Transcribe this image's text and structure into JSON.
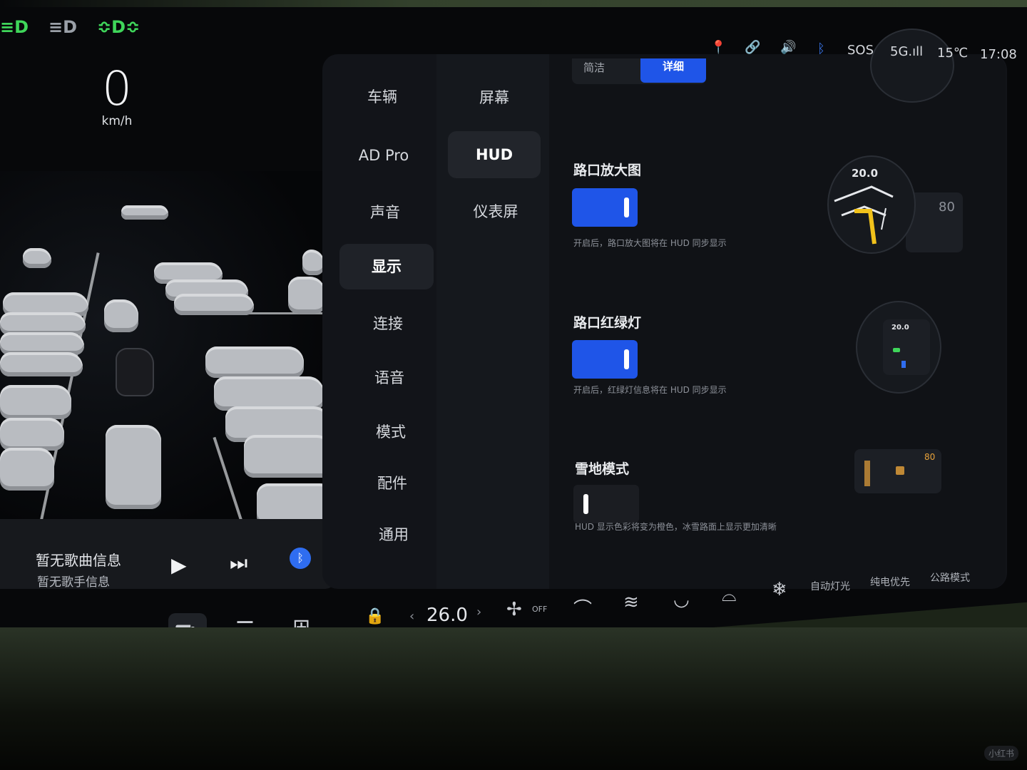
{
  "telltales": [
    {
      "icon": "headlight-icon",
      "glyph": "≡D",
      "color": "#3fd65a"
    },
    {
      "icon": "auto-headlight-icon",
      "glyph": "≡D",
      "color": "#9aa0a8"
    },
    {
      "icon": "parking-light-icon",
      "glyph": "≎D≎",
      "color": "#3fd65a"
    }
  ],
  "speed": {
    "value": "0",
    "unit": "km/h"
  },
  "media": {
    "song": "暂无歌曲信息",
    "artist": "暂无歌手信息",
    "play_icon": "▶",
    "next_icon": "⏭",
    "bt_icon": "ᛒ"
  },
  "status_bar": {
    "location_icon": "📍",
    "link_icon": "🔗",
    "volume_icon": "🔊",
    "bluetooth_icon": "ᛒ",
    "sos": "SOS",
    "network": "5G.ıll",
    "temperature": "15℃",
    "time": "17:08"
  },
  "nav_main": [
    {
      "label": "车辆"
    },
    {
      "label": "AD Pro"
    },
    {
      "label": "声音"
    },
    {
      "label": "显示",
      "active": true
    },
    {
      "label": "连接"
    },
    {
      "label": "语音"
    },
    {
      "label": "模式"
    },
    {
      "label": "配件"
    },
    {
      "label": "通用"
    }
  ],
  "nav_sub": [
    {
      "label": "屏幕"
    },
    {
      "label": "HUD",
      "active": true
    },
    {
      "label": "仪表屏"
    }
  ],
  "segment": {
    "option_a": "简洁",
    "option_b": "详细",
    "selected": "详细"
  },
  "settings": [
    {
      "title": "路口放大图",
      "on": true,
      "desc": "开启后，路口放大图将在 HUD 同步显示"
    },
    {
      "title": "路口红绿灯",
      "on": true,
      "desc": "开启后，红绿灯信息将在 HUD 同步显示"
    },
    {
      "title": "雪地模式",
      "on": false,
      "desc": "HUD 显示色彩将变为橙色，冰雪路面上显示更加清晰"
    }
  ],
  "previews": {
    "distance_large": "20.0",
    "speed_large": "80",
    "distance_small": "20.0",
    "speed_snow": "80"
  },
  "climate": {
    "lock_icon": "🔒",
    "temperature": "26.0",
    "fan_label": "OFF",
    "auto_light": "自动灯光",
    "pure_ev": "纯电优先",
    "highway_mode": "公路模式"
  },
  "watermark": "小红书",
  "colors": {
    "accent": "#1f55e8",
    "telltale_green": "#3fd65a"
  }
}
